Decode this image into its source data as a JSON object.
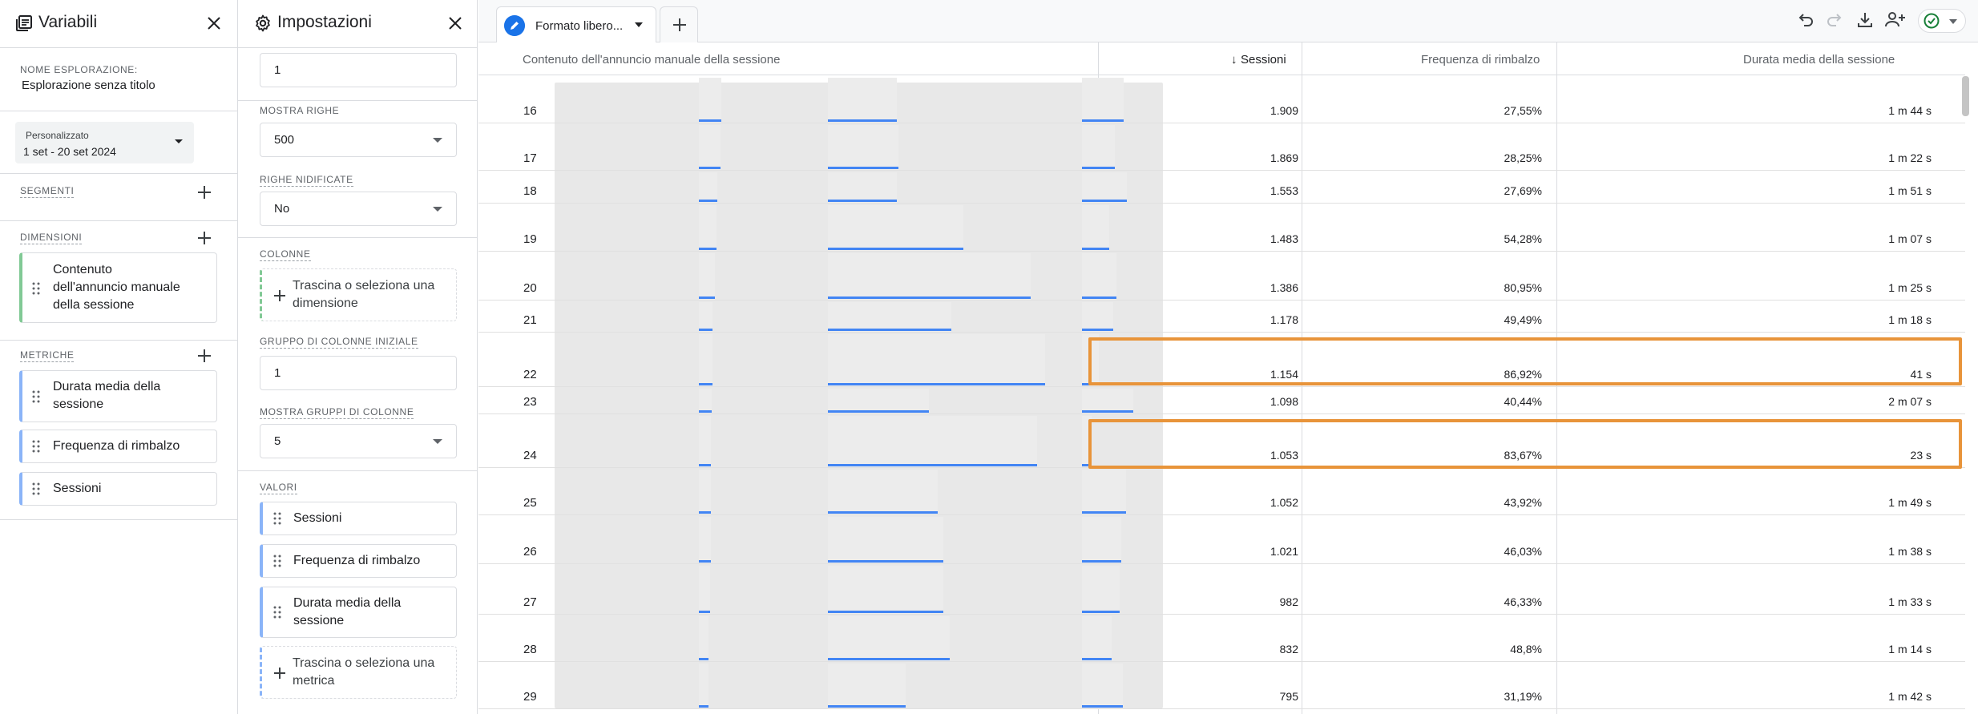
{
  "variables_panel": {
    "title": "Variabili",
    "exploration_name_label": "NOME ESPLORAZIONE:",
    "exploration_name": "Esplorazione senza titolo",
    "date_range": {
      "label": "Personalizzato",
      "value": "1 set - 20 set 2024"
    },
    "segments_label": "SEGMENTI",
    "dimensions_label": "DIMENSIONI",
    "dimensions": [
      "Contenuto",
      "dell'annuncio manuale",
      "della sessione"
    ],
    "metrics_label": "METRICHE",
    "metrics": [
      {
        "line1": "Durata media della",
        "line2": "sessione"
      },
      {
        "line1": "Frequenza di rimbalzo",
        "line2": ""
      },
      {
        "line1": "Sessioni",
        "line2": ""
      }
    ]
  },
  "settings_panel": {
    "title": "Impostazioni",
    "top_value": "1",
    "show_rows_label": "MOSTRA RIGHE",
    "show_rows_value": "500",
    "nested_rows_label": "RIGHE NIDIFICATE",
    "nested_rows_value": "No",
    "columns_label": "COLONNE",
    "columns_drop": {
      "line1": "Trascina o seleziona una",
      "line2": "dimensione"
    },
    "start_col_group_label": "GRUPPO DI COLONNE INIZIALE",
    "start_col_group_value": "1",
    "show_col_groups_label": "MOSTRA GRUPPI DI COLONNE",
    "show_col_groups_value": "5",
    "values_label": "VALORI",
    "values": [
      {
        "line1": "Sessioni",
        "line2": ""
      },
      {
        "line1": "Frequenza di rimbalzo",
        "line2": ""
      },
      {
        "line1": "Durata media della",
        "line2": "sessione"
      }
    ],
    "values_drop": {
      "line1": "Trascina o seleziona una",
      "line2": "metrica"
    }
  },
  "tabs": {
    "active_label": "Formato libero..."
  },
  "table": {
    "headers": {
      "dimension": "Contenuto dell'annuncio manuale della sessione",
      "sessions": "Sessioni",
      "sort_arrow": "↓",
      "bounce": "Frequenza di rimbalzo",
      "duration": "Durata media della sessione"
    },
    "rows": [
      {
        "idx": "16",
        "sessions": "1.909",
        "bounce": "27,55%",
        "duration": "1 m 44 s",
        "s_frac": 0.11,
        "b_frac": 0.275,
        "d_frac": 0.104
      },
      {
        "idx": "17",
        "sessions": "1.869",
        "bounce": "28,25%",
        "duration": "1 m 22 s",
        "s_frac": 0.108,
        "b_frac": 0.283,
        "d_frac": 0.082
      },
      {
        "idx": "18",
        "sessions": "1.553",
        "bounce": "27,69%",
        "duration": "1 m 51 s",
        "s_frac": 0.09,
        "b_frac": 0.277,
        "d_frac": 0.111
      },
      {
        "idx": "19",
        "sessions": "1.483",
        "bounce": "54,28%",
        "duration": "1 m 07 s",
        "s_frac": 0.086,
        "b_frac": 0.543,
        "d_frac": 0.067
      },
      {
        "idx": "20",
        "sessions": "1.386",
        "bounce": "80,95%",
        "duration": "1 m 25 s",
        "s_frac": 0.08,
        "b_frac": 0.81,
        "d_frac": 0.085
      },
      {
        "idx": "21",
        "sessions": "1.178",
        "bounce": "49,49%",
        "duration": "1 m 18 s",
        "s_frac": 0.068,
        "b_frac": 0.495,
        "d_frac": 0.078
      },
      {
        "idx": "22",
        "sessions": "1.154",
        "bounce": "86,92%",
        "duration": "41 s",
        "s_frac": 0.067,
        "b_frac": 0.869,
        "d_frac": 0.041
      },
      {
        "idx": "23",
        "sessions": "1.098",
        "bounce": "40,44%",
        "duration": "2 m 07 s",
        "s_frac": 0.064,
        "b_frac": 0.404,
        "d_frac": 0.127
      },
      {
        "idx": "24",
        "sessions": "1.053",
        "bounce": "83,67%",
        "duration": "23 s",
        "s_frac": 0.061,
        "b_frac": 0.837,
        "d_frac": 0.023
      },
      {
        "idx": "25",
        "sessions": "1.052",
        "bounce": "43,92%",
        "duration": "1 m 49 s",
        "s_frac": 0.061,
        "b_frac": 0.439,
        "d_frac": 0.109
      },
      {
        "idx": "26",
        "sessions": "1.021",
        "bounce": "46,03%",
        "duration": "1 m 38 s",
        "s_frac": 0.059,
        "b_frac": 0.46,
        "d_frac": 0.098
      },
      {
        "idx": "27",
        "sessions": "982",
        "bounce": "46,33%",
        "duration": "1 m 33 s",
        "s_frac": 0.057,
        "b_frac": 0.463,
        "d_frac": 0.093
      },
      {
        "idx": "28",
        "sessions": "832",
        "bounce": "48,8%",
        "duration": "1 m 14 s",
        "s_frac": 0.048,
        "b_frac": 0.488,
        "d_frac": 0.074
      },
      {
        "idx": "29",
        "sessions": "795",
        "bounce": "31,19%",
        "duration": "1 m 42 s",
        "s_frac": 0.046,
        "b_frac": 0.312,
        "d_frac": 0.102
      }
    ],
    "highlighted_rows": [
      "22",
      "24"
    ]
  },
  "colors": {
    "accent": "#1a73e8",
    "bar": "#4285f4",
    "highlight": "#e8943a",
    "dimension": "#81c995",
    "metric": "#8ab4f8"
  }
}
